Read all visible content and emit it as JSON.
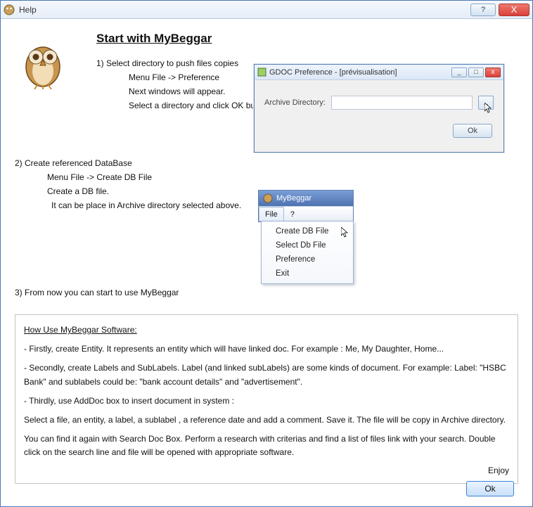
{
  "window": {
    "title": "Help",
    "help_btn": "?",
    "close_btn": "X",
    "ok_btn": "Ok"
  },
  "heading": "Start with MyBeggar",
  "step1": {
    "title": "1) Select directory to push files copies",
    "line1": "Menu File -> Preference",
    "line2": "Next windows will appear.",
    "line3": "Select a directory and click OK button"
  },
  "pref_window": {
    "title": "GDOC Preference - [prévisualisation]",
    "field_label": "Archive Directory:",
    "browse": "...",
    "ok": "Ok"
  },
  "step2": {
    "title": "2) Create referenced DataBase",
    "line1": "Menu File -> Create DB File",
    "line2": "Create a DB file.",
    "line3": "It can be place in Archive directory selected above."
  },
  "menu_window": {
    "title": "MyBeggar",
    "file": "File",
    "help": "?",
    "items": [
      "Create DB File",
      "Select Db File",
      "Preference",
      "Exit"
    ]
  },
  "step3": "3) From now you can start to use MyBeggar",
  "howto": {
    "title": "How Use MyBeggar Software:",
    "p1": "- Firstly, create Entity. It represents an entity which will have linked doc. For example : Me, My Daughter, Home...",
    "p2": "- Secondly, create Labels and SubLabels. Label (and linked subLabels) are some kinds of document. For example: Label: \"HSBC Bank\" and sublabels could be: \"bank account details\" and \"advertisement\".",
    "p3": "- Thirdly, use AddDoc box to insert document in system :",
    "p4": "Select a file, an entity, a label, a sublabel , a reference date and add a comment. Save it. The file will be copy in Archive directory.",
    "p5": "You can find it again with Search Doc Box. Perform a research with criterias and find a list of files link with your search. Double click on the search line and file will be opened with appropriate software.",
    "enjoy": "Enjoy"
  }
}
